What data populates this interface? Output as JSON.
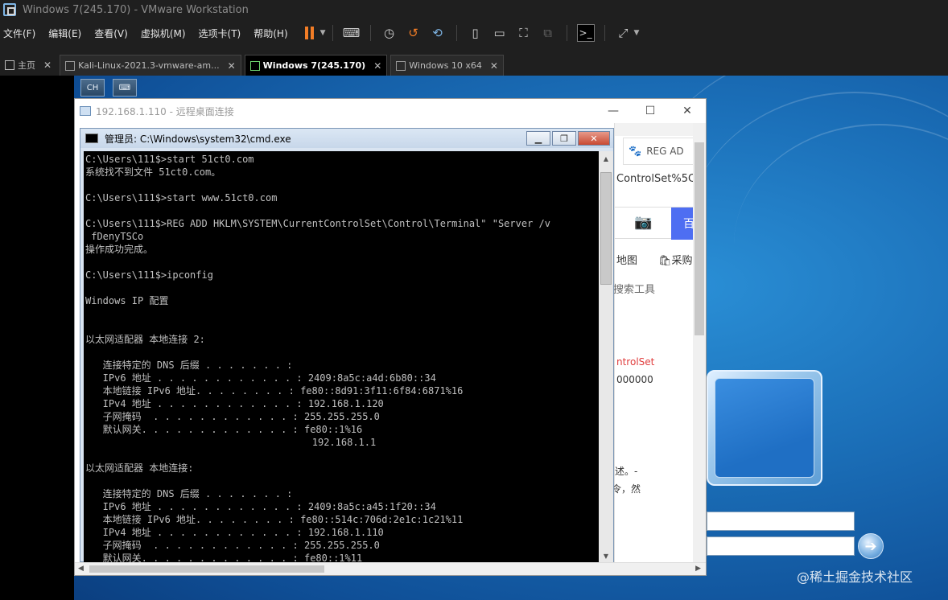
{
  "vm": {
    "title": "Windows 7(245.170) - VMware Workstation",
    "menu": [
      "文件(F)",
      "编辑(E)",
      "查看(V)",
      "虚拟机(M)",
      "选项卡(T)",
      "帮助(H)"
    ],
    "tabs": [
      {
        "label": "主页"
      },
      {
        "label": "Kali-Linux-2021.3-vmware-am..."
      },
      {
        "label": "Windows 7(245.170)"
      },
      {
        "label": "Windows 10 x64"
      }
    ],
    "rdp_bar": [
      "CH",
      "⌨"
    ]
  },
  "rdp": {
    "title": "192.168.1.110 - 远程桌面连接"
  },
  "cmd": {
    "title": "管理员: C:\\Windows\\system32\\cmd.exe",
    "lines": [
      "C:\\Users\\111$>start 51ct0.com",
      "系统找不到文件 51ct0.com。",
      "",
      "C:\\Users\\111$>start www.51ct0.com",
      "",
      "C:\\Users\\111$>REG ADD HKLM\\SYSTEM\\CurrentControlSet\\Control\\Terminal\" \"Server /v",
      " fDenyTSCo",
      "操作成功完成。",
      "",
      "C:\\Users\\111$>ipconfig",
      "",
      "Windows IP 配置",
      "",
      "",
      "以太网适配器 本地连接 2:",
      "",
      "   连接特定的 DNS 后缀 . . . . . . . :",
      "   IPv6 地址 . . . . . . . . . . . . : 2409:8a5c:a4d:6b80::34",
      "   本地链接 IPv6 地址. . . . . . . . : fe80::8d91:3f11:6f84:6871%16",
      "   IPv4 地址 . . . . . . . . . . . . : 192.168.1.120",
      "   子网掩码  . . . . . . . . . . . . : 255.255.255.0",
      "   默认网关. . . . . . . . . . . . . : fe80::1%16",
      "                                       192.168.1.1",
      "",
      "以太网适配器 本地连接:",
      "",
      "   连接特定的 DNS 后缀 . . . . . . . :",
      "   IPv6 地址 . . . . . . . . . . . . : 2409:8a5c:a45:1f20::34",
      "   本地链接 IPv6 地址. . . . . . . . : fe80::514c:706d:2e1c:1c21%11",
      "   IPv4 地址 . . . . . . . . . . . . : 192.168.1.110",
      "   子网掩码  . . . . . . . . . . . . : 255.255.255.0",
      "   默认网关. . . . . . . . . . . . . : fe80::1%11"
    ]
  },
  "browser": {
    "tab_label": "REG AD",
    "url_fragment": "ControlSet%5C",
    "search_button": "百",
    "nav_map": "地图",
    "nav_shop": "采购",
    "tools": "搜索工具",
    "red_text": "ntrolSet",
    "number": "000000",
    "desc1": "述。-",
    "desc2": "令，然"
  },
  "watermark": "@稀土掘金技术社区",
  "colors": {
    "pause": "#f27d26",
    "win7_blue": "#1b6fb8",
    "baidu_blue": "#4e6ef2"
  }
}
